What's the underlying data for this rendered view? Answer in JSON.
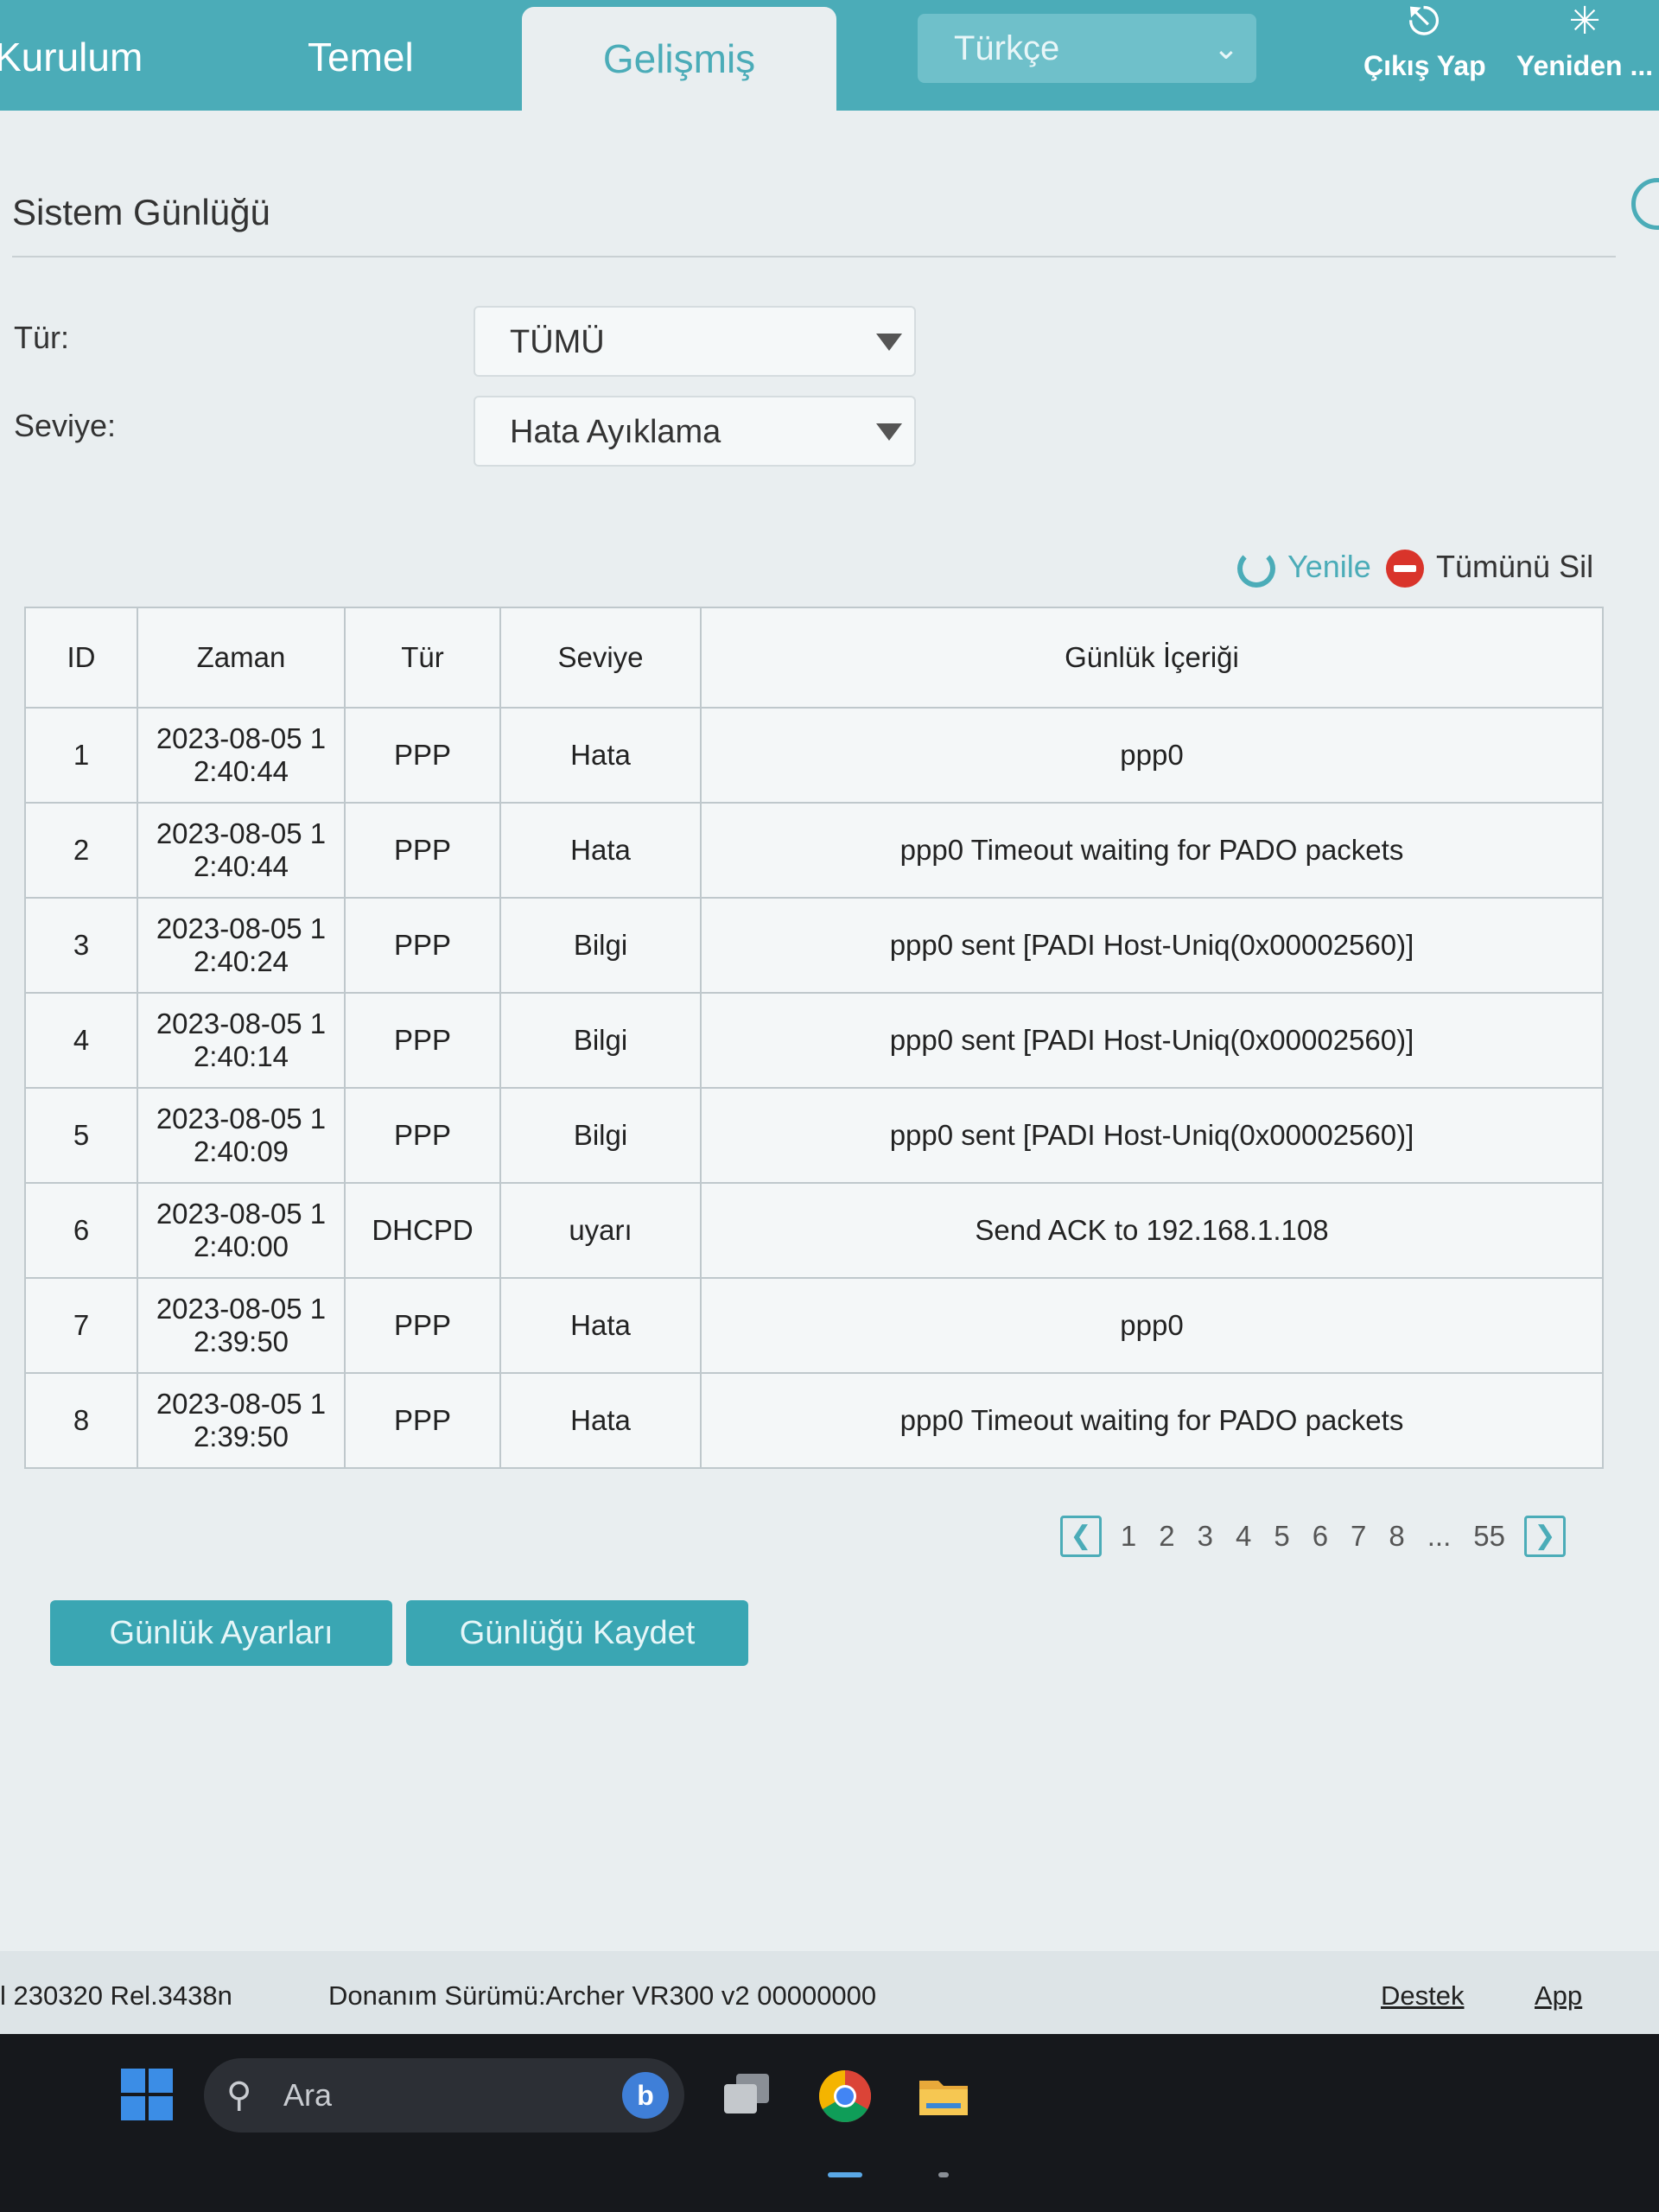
{
  "nav": {
    "tabs": [
      "Kurulum",
      "Temel",
      "Gelişmiş"
    ],
    "active_tab": "Gelişmiş",
    "language": "Türkçe",
    "logout_label": "Çıkış Yap",
    "reboot_label": "Yeniden ..."
  },
  "page": {
    "title": "Sistem Günlüğü",
    "type_label": "Tür:",
    "type_value": "TÜMÜ",
    "level_label": "Seviye:",
    "level_value": "Hata Ayıklama",
    "refresh_label": "Yenile",
    "delete_all_label": "Tümünü Sil"
  },
  "table": {
    "headers": [
      "ID",
      "Zaman",
      "Tür",
      "Seviye",
      "Günlük İçeriği"
    ],
    "rows": [
      {
        "id": "1",
        "time1": "2023-08-05 1",
        "time2": "2:40:44",
        "type": "PPP",
        "level": "Hata",
        "content": "ppp0"
      },
      {
        "id": "2",
        "time1": "2023-08-05 1",
        "time2": "2:40:44",
        "type": "PPP",
        "level": "Hata",
        "content": "ppp0 Timeout waiting for PADO packets"
      },
      {
        "id": "3",
        "time1": "2023-08-05 1",
        "time2": "2:40:24",
        "type": "PPP",
        "level": "Bilgi",
        "content": "ppp0 sent [PADI Host-Uniq(0x00002560)]"
      },
      {
        "id": "4",
        "time1": "2023-08-05 1",
        "time2": "2:40:14",
        "type": "PPP",
        "level": "Bilgi",
        "content": "ppp0 sent [PADI Host-Uniq(0x00002560)]"
      },
      {
        "id": "5",
        "time1": "2023-08-05 1",
        "time2": "2:40:09",
        "type": "PPP",
        "level": "Bilgi",
        "content": "ppp0 sent [PADI Host-Uniq(0x00002560)]"
      },
      {
        "id": "6",
        "time1": "2023-08-05 1",
        "time2": "2:40:00",
        "type": "DHCPD",
        "level": "uyarı",
        "content": "Send ACK to 192.168.1.108"
      },
      {
        "id": "7",
        "time1": "2023-08-05 1",
        "time2": "2:39:50",
        "type": "PPP",
        "level": "Hata",
        "content": "ppp0"
      },
      {
        "id": "8",
        "time1": "2023-08-05 1",
        "time2": "2:39:50",
        "type": "PPP",
        "level": "Hata",
        "content": "ppp0 Timeout waiting for PADO packets"
      }
    ]
  },
  "pagination": {
    "pages": [
      "1",
      "2",
      "3",
      "4",
      "5",
      "6",
      "7",
      "8"
    ],
    "ellipsis": "...",
    "last": "55"
  },
  "buttons": {
    "log_settings": "Günlük Ayarları",
    "save_log": "Günlüğü Kaydet"
  },
  "footer": {
    "firmware": "l 230320 Rel.3438n",
    "hardware": "Donanım Sürümü:Archer VR300 v2 00000000",
    "support": "Destek",
    "app": "App"
  },
  "taskbar": {
    "search_placeholder": "Ara"
  },
  "colors": {
    "accent": "#4bacb8",
    "button": "#3aa6b3",
    "delete": "#d9342b"
  }
}
